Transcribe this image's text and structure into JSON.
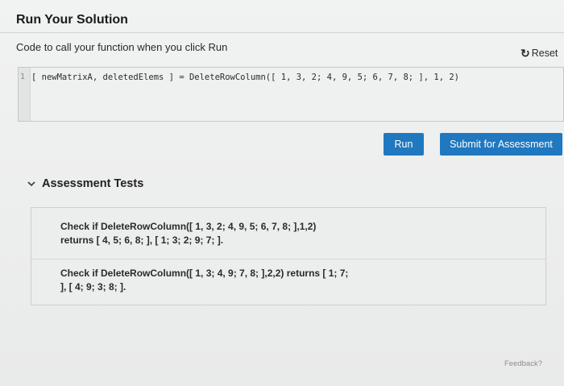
{
  "solution": {
    "title": "Run Your Solution",
    "subtitle": "Code to call your function when you click Run",
    "reset_label": "Reset"
  },
  "editor": {
    "line_number": "1",
    "code": "[ newMatrixA, deletedElems ] = DeleteRowColumn([ 1, 3, 2; 4, 9, 5; 6, 7, 8; ], 1, 2)"
  },
  "actions": {
    "run_label": "Run",
    "submit_label": "Submit for Assessment"
  },
  "assessment": {
    "title": "Assessment Tests",
    "tests": [
      {
        "text_line1": "Check if DeleteRowColumn([ 1, 3, 2; 4, 9, 5; 6, 7, 8; ],1,2)",
        "text_line2": "returns [ 4, 5; 6, 8; ], [ 1; 3; 2; 9; 7; ]."
      },
      {
        "text_line1": "Check if DeleteRowColumn([ 1, 3; 4, 9; 7, 8; ],2,2) returns [ 1; 7;",
        "text_line2": "], [ 4; 9; 3; 8; ]."
      }
    ]
  },
  "footer": {
    "feedback_label": "Feedback?"
  },
  "colors": {
    "button_blue": "#1f78c0",
    "background": "#e9ebeb"
  }
}
